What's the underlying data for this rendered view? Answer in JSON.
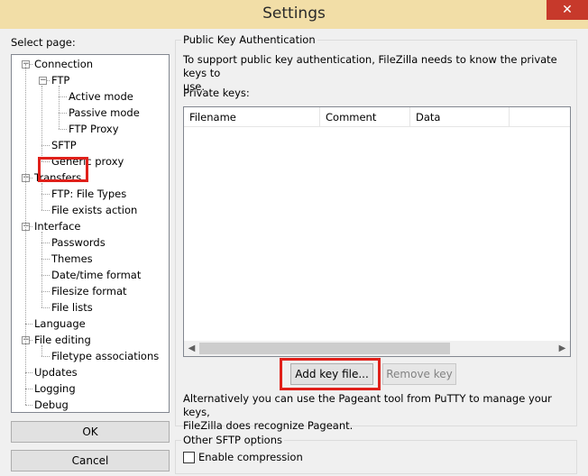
{
  "window": {
    "title": "Settings",
    "close_glyph": "✕"
  },
  "sidebar": {
    "select_label": "Select page:",
    "tree": [
      {
        "label": "Connection",
        "level": 0,
        "expander": "⊟"
      },
      {
        "label": "FTP",
        "level": 1,
        "expander": "⊟"
      },
      {
        "label": "Active mode",
        "level": 2
      },
      {
        "label": "Passive mode",
        "level": 2
      },
      {
        "label": "FTP Proxy",
        "level": 2
      },
      {
        "label": "SFTP",
        "level": 1,
        "selected": true
      },
      {
        "label": "Generic proxy",
        "level": 1
      },
      {
        "label": "Transfers",
        "level": 0,
        "expander": "⊟"
      },
      {
        "label": "FTP: File Types",
        "level": 1
      },
      {
        "label": "File exists action",
        "level": 1
      },
      {
        "label": "Interface",
        "level": 0,
        "expander": "⊟"
      },
      {
        "label": "Passwords",
        "level": 1
      },
      {
        "label": "Themes",
        "level": 1
      },
      {
        "label": "Date/time format",
        "level": 1
      },
      {
        "label": "Filesize format",
        "level": 1
      },
      {
        "label": "File lists",
        "level": 1
      },
      {
        "label": "Language",
        "level": 0
      },
      {
        "label": "File editing",
        "level": 0,
        "expander": "⊟"
      },
      {
        "label": "Filetype associations",
        "level": 1
      },
      {
        "label": "Updates",
        "level": 0
      },
      {
        "label": "Logging",
        "level": 0
      },
      {
        "label": "Debug",
        "level": 0
      }
    ],
    "ok_label": "OK",
    "cancel_label": "Cancel"
  },
  "pubkey": {
    "legend": "Public Key Authentication",
    "description_line1": "To support public key authentication, FileZilla needs to know the private keys to",
    "description_line2": "use.",
    "private_keys_label": "Private keys:",
    "columns": [
      "Filename",
      "Comment",
      "Data"
    ],
    "rows": [],
    "add_key_label": "Add key file...",
    "remove_key_label": "Remove key",
    "pageant_line1": "Alternatively you can use the Pageant tool from PuTTY to manage your keys,",
    "pageant_line2": "FileZilla does recognize Pageant."
  },
  "other": {
    "legend": "Other SFTP options",
    "compression_label": "Enable compression",
    "compression_checked": false
  },
  "colors": {
    "highlight": "#e0201a",
    "close": "#c7392b",
    "title_bar": "#f2dea7"
  }
}
